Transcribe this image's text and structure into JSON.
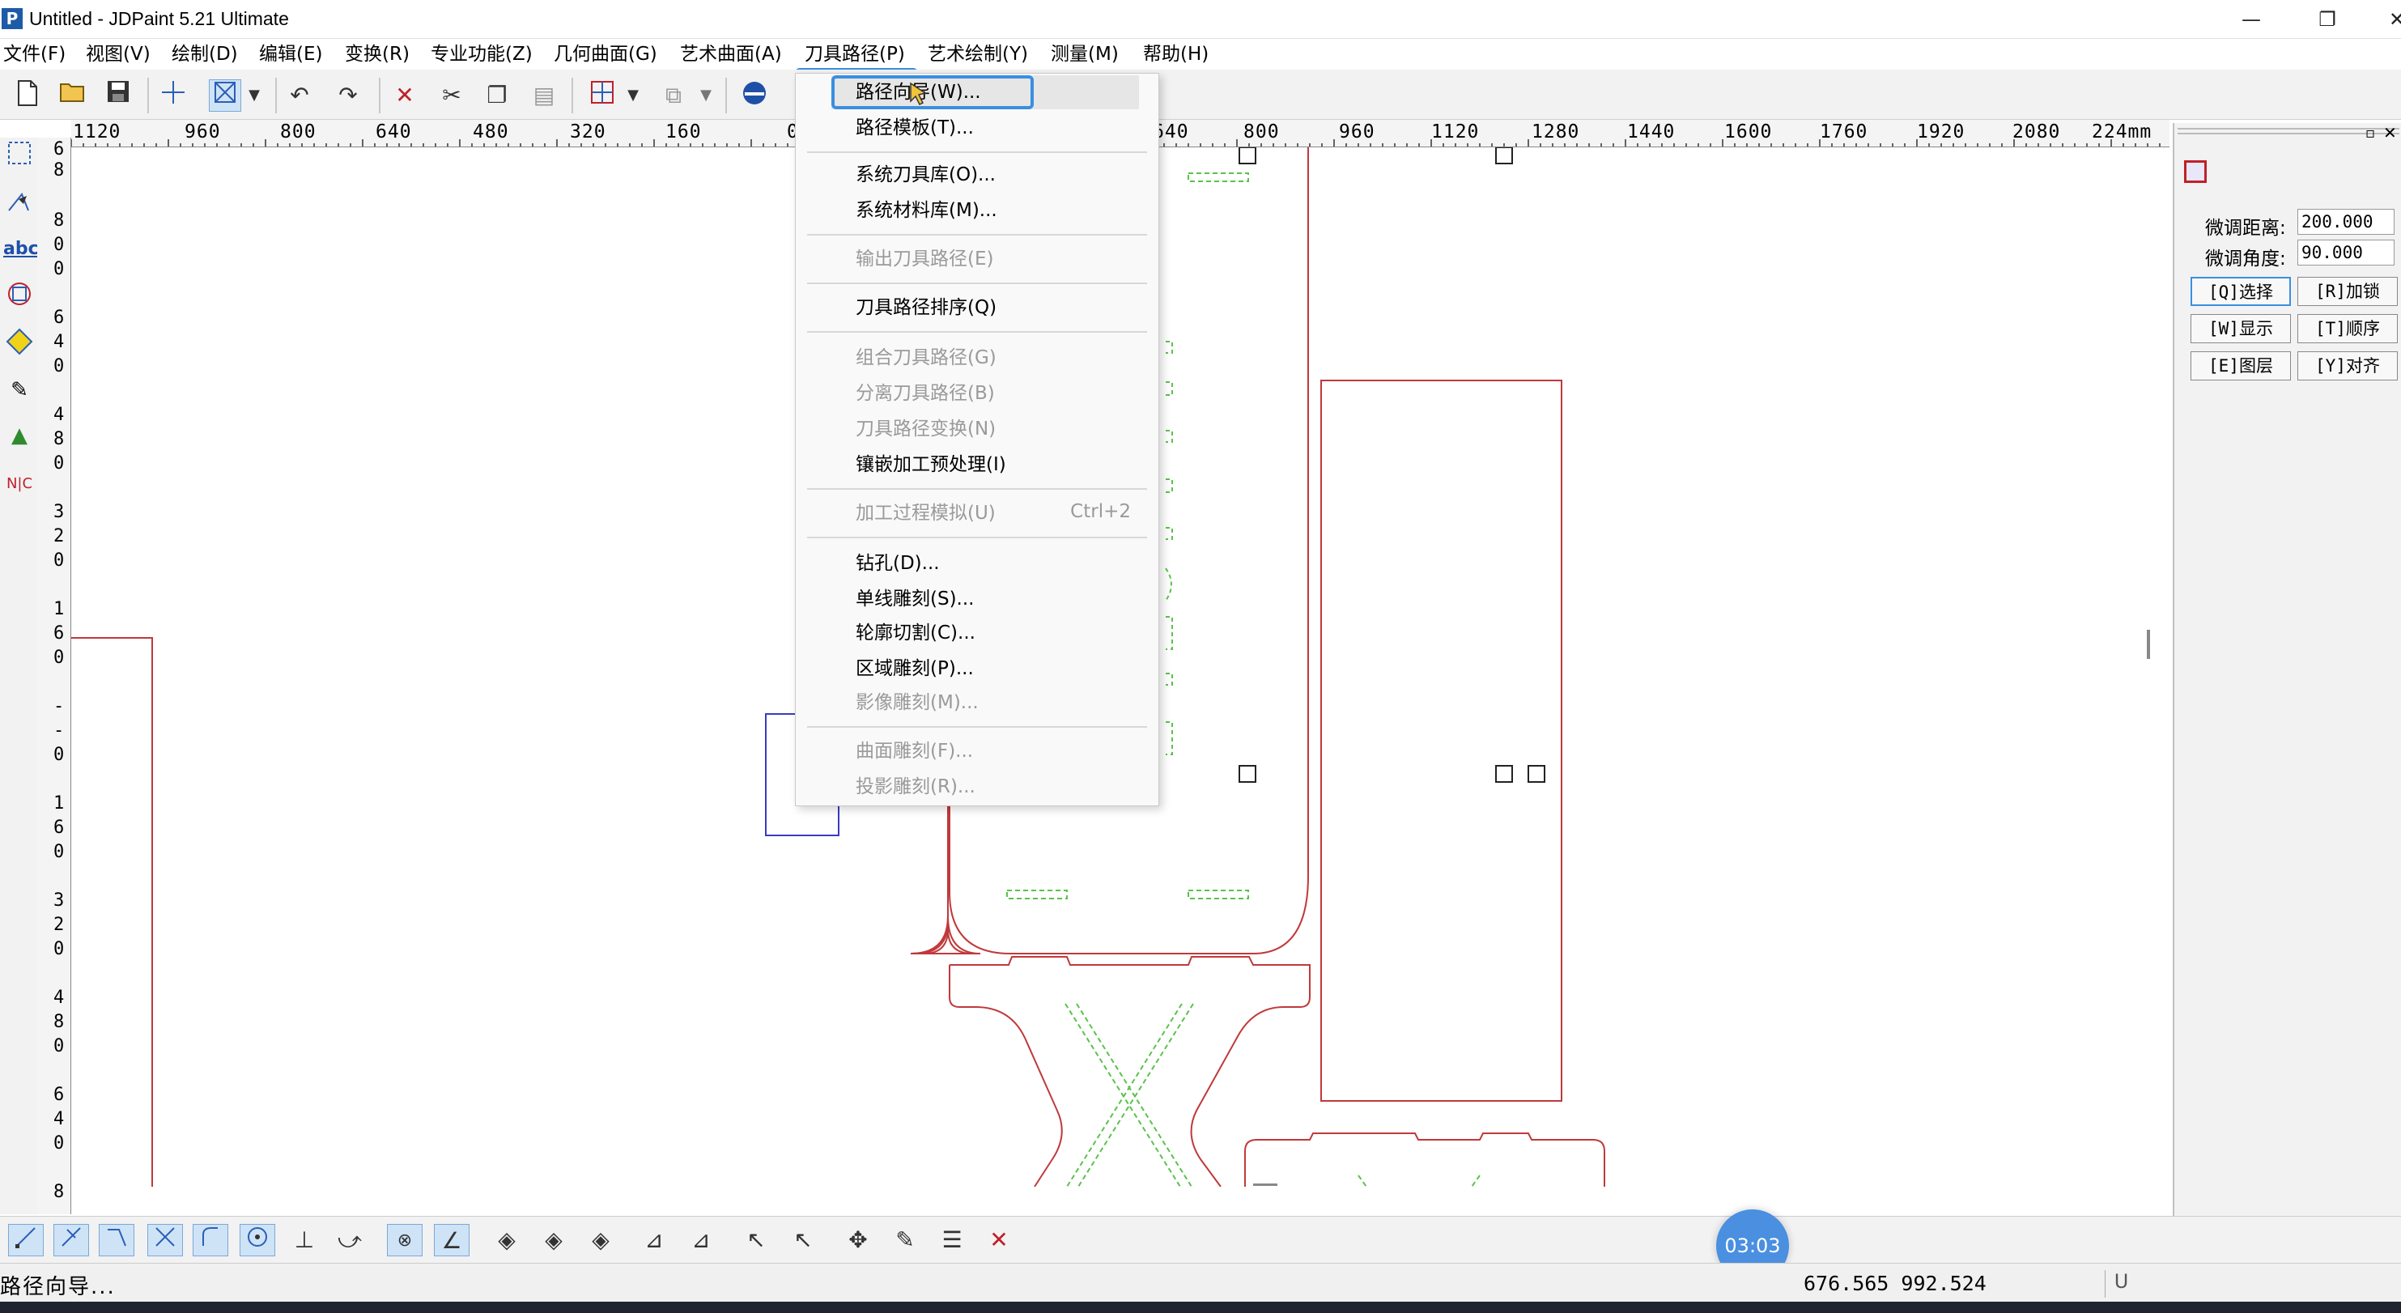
{
  "window": {
    "title": "Untitled - JDPaint 5.21 Ultimate",
    "app_icon": "P",
    "minimize": "—",
    "restore": "❐",
    "close": "✕"
  },
  "menubar": {
    "items": [
      "文件(F)",
      "视图(V)",
      "绘制(D)",
      "编辑(E)",
      "变换(R)",
      "专业功能(Z)",
      "几何曲面(G)",
      "艺术曲面(A)",
      "刀具路径(P)",
      "艺术绘制(Y)",
      "测量(M)",
      "帮助(H)"
    ],
    "active_index": 8
  },
  "toolbar": {
    "icons": [
      "new-file-icon",
      "open-folder-icon",
      "save-icon",
      "crosshair-icon",
      "select-box-icon",
      "dropdown-arrow-icon",
      "undo-icon",
      "redo-icon",
      "delete-icon",
      "cut-icon",
      "copy-icon",
      "paste-icon",
      "snap-grid-icon",
      "dropdown-arrow-icon",
      "view-3d-icon",
      "dropdown-arrow-icon",
      "shade-icon"
    ]
  },
  "ruler": {
    "h_labels": [
      "1120",
      "960",
      "800",
      "640",
      "480",
      "320",
      "160",
      "0",
      "640",
      "800",
      "960",
      "1120",
      "1280",
      "1440",
      "1600",
      "1760",
      "1920",
      "2080",
      "224mm"
    ],
    "v_labels": [
      "6",
      "8",
      "8",
      "0",
      "0",
      "6",
      "4",
      "0",
      "4",
      "8",
      "0",
      "3",
      "2",
      "0",
      "1",
      "6",
      "0",
      "-",
      "-",
      "0",
      "1",
      "6",
      "0",
      "3",
      "2",
      "0",
      "4",
      "8",
      "0",
      "6",
      "4",
      "0",
      "8"
    ]
  },
  "dropdown": {
    "items": [
      {
        "label": "路径向导(W)...",
        "disabled": false
      },
      {
        "label": "路径模板(T)...",
        "disabled": false
      },
      {
        "label": "系统刀具库(O)...",
        "disabled": false
      },
      {
        "label": "系统材料库(M)...",
        "disabled": false
      },
      {
        "label": "输出刀具路径(E)",
        "disabled": true
      },
      {
        "label": "刀具路径排序(Q)",
        "disabled": false
      },
      {
        "label": "组合刀具路径(G)",
        "disabled": true
      },
      {
        "label": "分离刀具路径(B)",
        "disabled": true
      },
      {
        "label": "刀具路径变换(N)",
        "disabled": true
      },
      {
        "label": "镶嵌加工预处理(I)",
        "disabled": false
      },
      {
        "label": "加工过程模拟(U)",
        "disabled": true,
        "shortcut": "Ctrl+2"
      },
      {
        "label": "钻孔(D)...",
        "disabled": false
      },
      {
        "label": "单线雕刻(S)...",
        "disabled": false
      },
      {
        "label": "轮廓切割(C)...",
        "disabled": false
      },
      {
        "label": "区域雕刻(P)...",
        "disabled": false
      },
      {
        "label": "影像雕刻(M)...",
        "disabled": true
      },
      {
        "label": "曲面雕刻(F)...",
        "disabled": true
      },
      {
        "label": "投影雕刻(R)...",
        "disabled": true
      }
    ]
  },
  "right_panel": {
    "distance_label": "微调距离:",
    "distance_value": "200.000",
    "angle_label": "微调角度:",
    "angle_value": "90.000",
    "buttons": [
      "[Q]选择",
      "[R]加锁",
      "[W]显示",
      "[T]顺序",
      "[E]图层",
      "[Y]对齐"
    ]
  },
  "status": {
    "text": "路径向导...",
    "coords": "676.565  992.524",
    "indicator": "U"
  },
  "timer": "03:03",
  "colors": {
    "contour": "#c0393b",
    "toolpath_dash": "#5ac24a",
    "select_rect": "#3b3bc0",
    "highlight": "#3a8fe0"
  }
}
